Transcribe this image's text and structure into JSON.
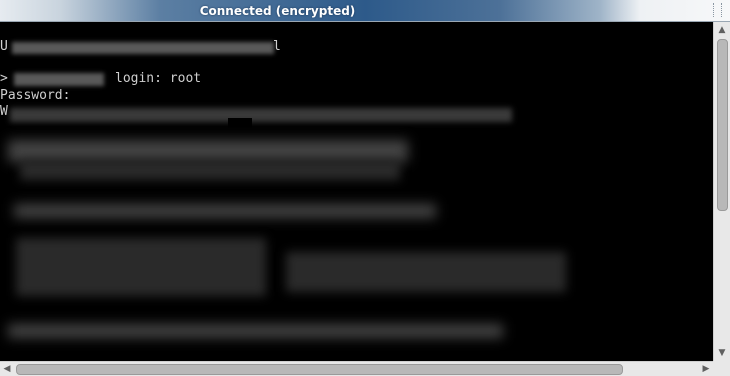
{
  "window": {
    "title": "Connected (encrypted)"
  },
  "terminal": {
    "line1_prefix": "U",
    "line1_suffix": "l",
    "login_prefix": ">",
    "login_text": "login: root",
    "password_label": "Password:",
    "line4_prefix": "W"
  },
  "scrollbars": {
    "up_glyph": "▲",
    "down_glyph": "▼",
    "left_glyph": "◀",
    "right_glyph": "▶"
  }
}
